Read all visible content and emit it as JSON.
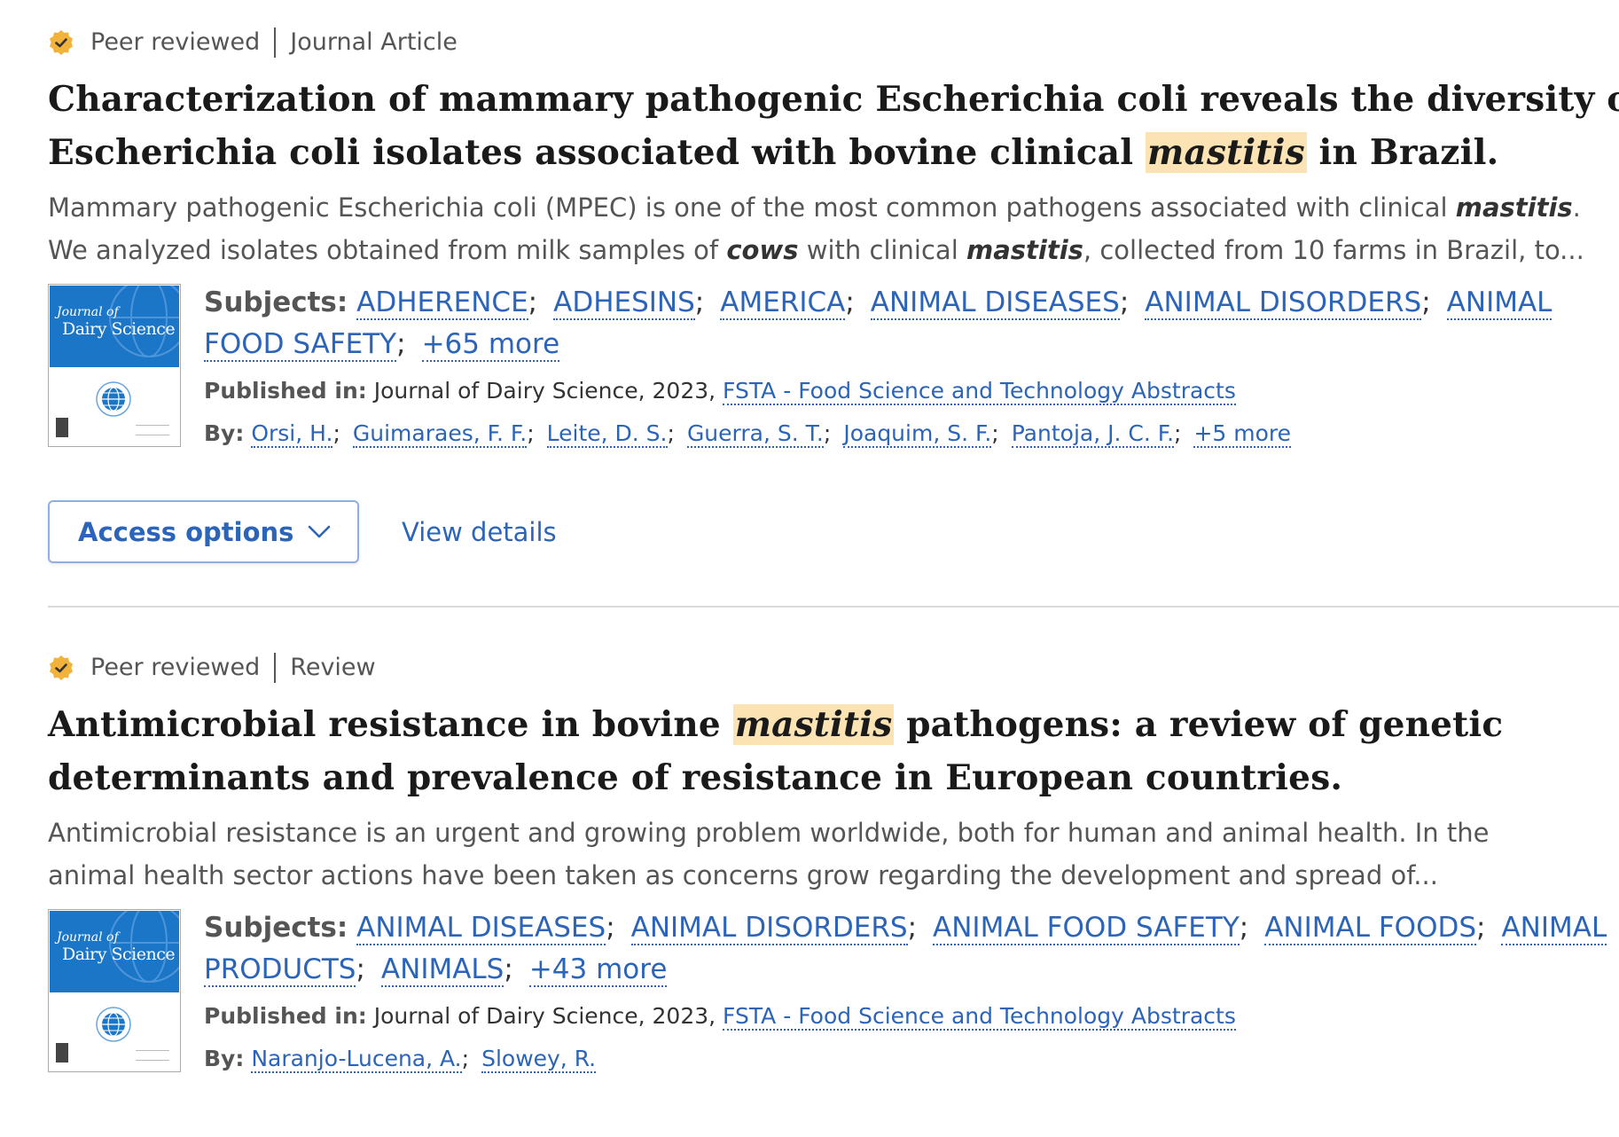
{
  "results": [
    {
      "peer_reviewed": "Peer reviewed",
      "type": "Journal Article",
      "title_pre": "Characterization of mammary pathogenic Escherichia coli reveals the diversity of Escherichia coli isolates associated with bovine clinical ",
      "title_hl": "mastitis",
      "title_post": " in Brazil.",
      "title_line1": "Characterization of mammary pathogenic Escherichia coli reveals the diversity of",
      "title_line2_pre": "Escherichia coli isolates associated with bovine clinical ",
      "abstract_line1_pre": "Mammary pathogenic Escherichia coli (MPEC) is one of the most common pathogens associated with clinical ",
      "abstract_line1_b": "mastitis",
      "abstract_line1_post": ".",
      "abstract_line2_a": "We analyzed isolates obtained from milk samples of ",
      "abstract_line2_b1": "cows",
      "abstract_line2_c": " with clinical ",
      "abstract_line2_b2": "mastitis",
      "abstract_line2_d": ", collected from 10 farms in Brazil, to...",
      "cover": {
        "journal_of": "Journal of",
        "name": "Dairy Science"
      },
      "subjects_label": "Subjects:",
      "subjects": [
        "ADHERENCE",
        "ADHESINS",
        "AMERICA",
        "ANIMAL DISEASES",
        "ANIMAL DISORDERS",
        "ANIMAL FOOD SAFETY"
      ],
      "subjects_more": "+65 more",
      "published_label": "Published in:",
      "published_text": "Journal of Dairy Science, 2023, ",
      "published_link": "FSTA - Food Science and Technology Abstracts",
      "by_label": "By:",
      "authors": [
        "Orsi, H.",
        "Guimaraes, F. F.",
        "Leite, D. S.",
        "Guerra, S. T.",
        "Joaquim, S. F.",
        "Pantoja, J. C. F."
      ],
      "authors_more": "+5 more",
      "access_label": "Access options",
      "view_details": "View details"
    },
    {
      "peer_reviewed": "Peer reviewed",
      "type": "Review",
      "title_line1_pre": "Antimicrobial resistance in bovine ",
      "title_hl": "mastitis",
      "title_line1_post": " pathogens: a review of genetic",
      "title_line2": "determinants and prevalence of resistance in European countries.",
      "abstract_line1": "Antimicrobial resistance is an urgent and growing problem worldwide, both for human and animal health. In the",
      "abstract_line2": "animal health sector actions have been taken as concerns grow regarding the development and spread of...",
      "cover": {
        "journal_of": "Journal of",
        "name": "Dairy Science"
      },
      "subjects_label": "Subjects:",
      "subjects": [
        "ANIMAL DISEASES",
        "ANIMAL DISORDERS",
        "ANIMAL FOOD SAFETY",
        "ANIMAL FOODS",
        "ANIMAL PRODUCTS",
        "ANIMALS"
      ],
      "subjects_more": "+43 more",
      "published_label": "Published in:",
      "published_text": "Journal of Dairy Science, 2023, ",
      "published_link": "FSTA - Food Science and Technology Abstracts",
      "by_label": "By:",
      "authors": [
        "Naranjo-Lucena, A.",
        "Slowey, R."
      ]
    }
  ]
}
